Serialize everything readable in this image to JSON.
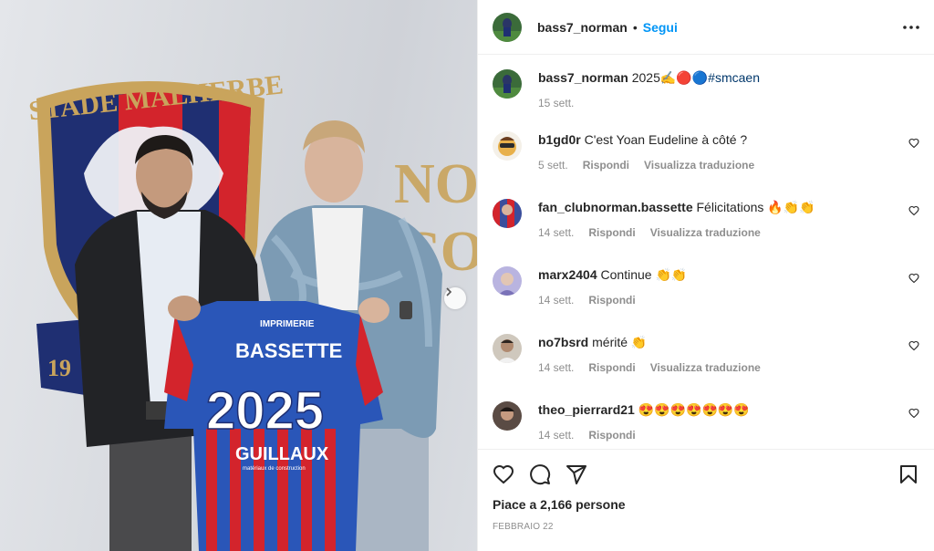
{
  "post": {
    "author": "bass7_norman",
    "separator": "•",
    "follow_label": "Segui",
    "more_icon": "more-options-icon",
    "caption": {
      "user": "bass7_norman",
      "text": "2025✍🔴🔵",
      "hashtag": "#smcaen",
      "time": "15 sett."
    },
    "comments": [
      {
        "user": "b1gd0r",
        "text": "C'est Yoan Eudeline à côté ?",
        "time": "5 sett.",
        "reply": "Rispondi",
        "translate": "Visualizza traduzione",
        "avatar_color": "#d9a63a"
      },
      {
        "user": "fan_clubnorman.bassette",
        "text": "Félicitations 🔥👏👏",
        "time": "14 sett.",
        "reply": "Rispondi",
        "translate": "Visualizza traduzione",
        "avatar_color": "#3a4e9c"
      },
      {
        "user": "marx2404",
        "text": "Continue 👏👏",
        "time": "14 sett.",
        "reply": "Rispondi",
        "translate": "",
        "avatar_color": "#a9a3d6"
      },
      {
        "user": "no7bsrd",
        "text": "mérité 👏",
        "time": "14 sett.",
        "reply": "Rispondi",
        "translate": "Visualizza traduzione",
        "avatar_color": "#8f8577"
      },
      {
        "user": "theo_pierrard21",
        "text": "😍😍😍😍😍😍😍",
        "time": "14 sett.",
        "reply": "Rispondi",
        "translate": "",
        "avatar_color": "#5a4b44"
      }
    ],
    "likes": "Piace a 2,166 persone",
    "date": "FEBBRAIO 22"
  },
  "photo": {
    "banner_text": "STADE MALHERBE",
    "side_text_1": "NO",
    "side_text_2": "CO",
    "crest_number": "19",
    "jersey_sponsor_top": "IMPRIMERIE",
    "jersey_name": "BASSETTE",
    "jersey_number": "2025",
    "jersey_sponsor": "GUILLAUX",
    "jersey_sponsor_sub": "matériaux de construction",
    "colors": {
      "navy": "#1f2f72",
      "red": "#d3242c",
      "gold": "#c9a45c"
    }
  }
}
